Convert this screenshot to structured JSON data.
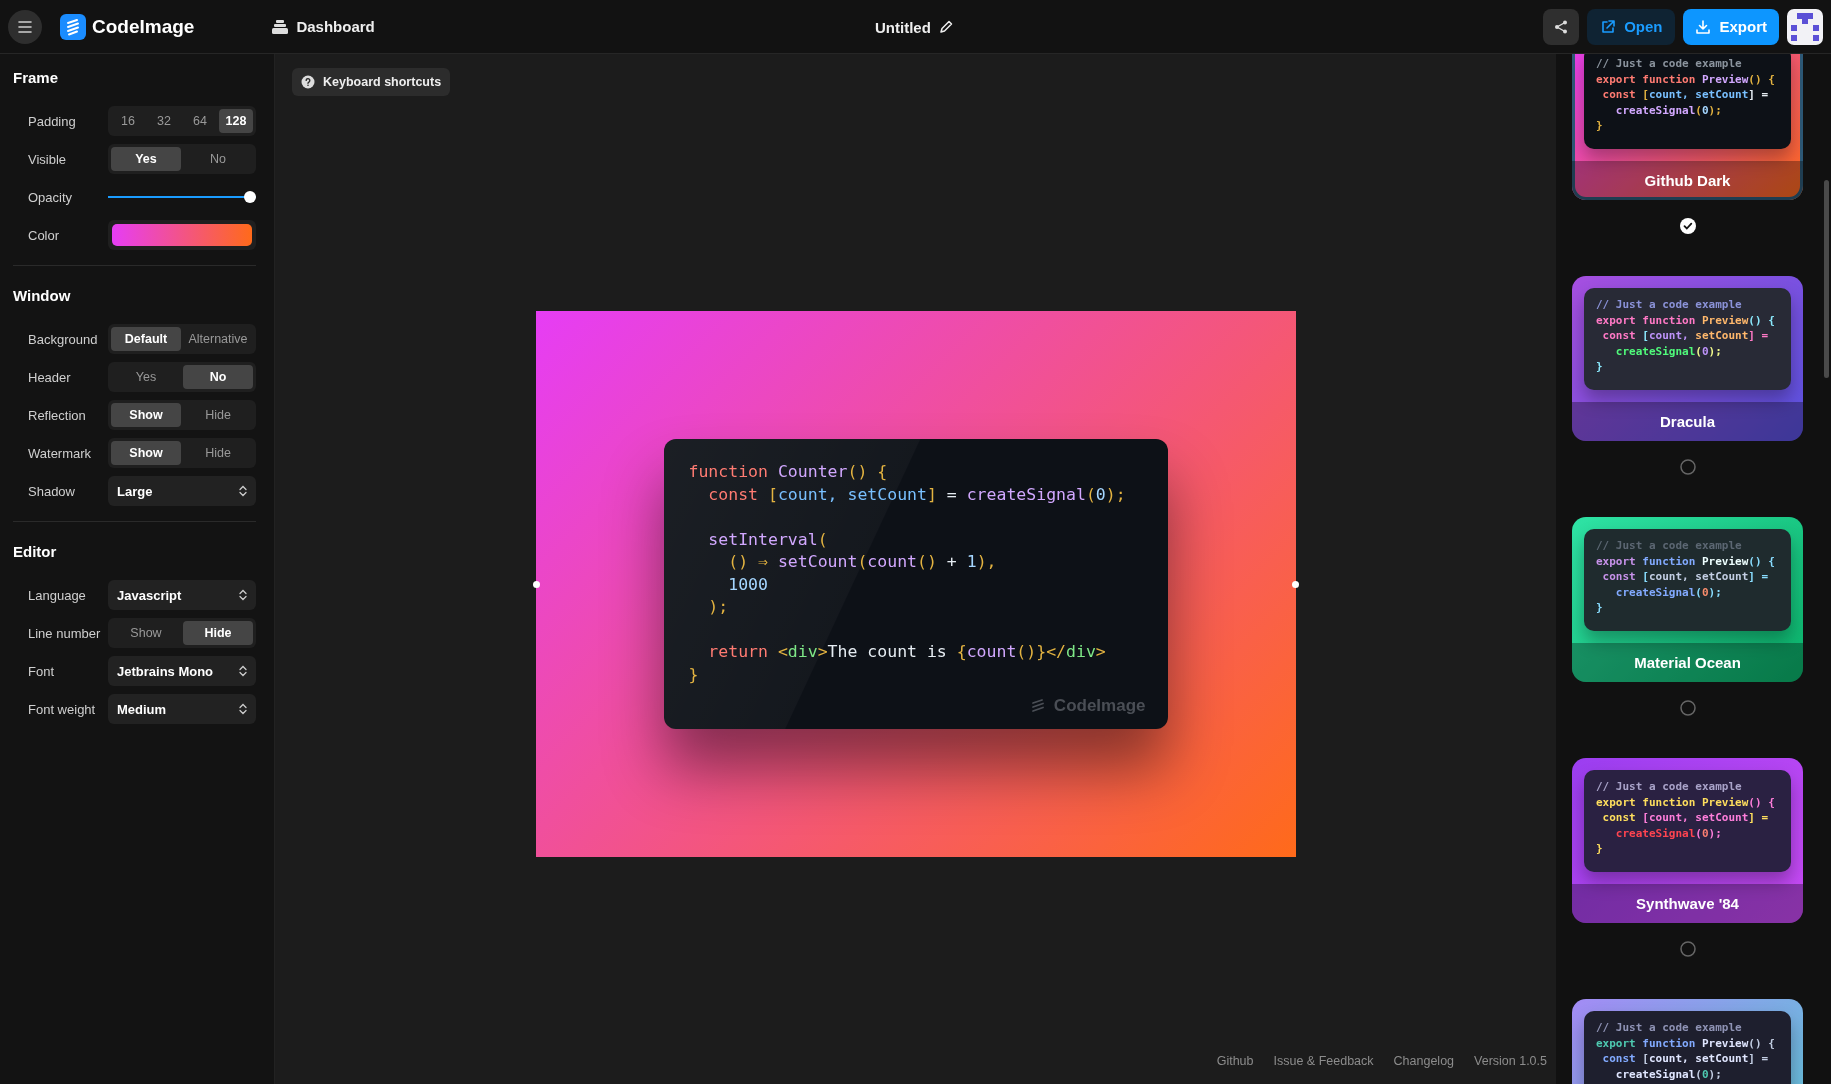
{
  "topbar": {
    "app_name": "CodeImage",
    "nav_link": "Dashboard",
    "title": "Untitled",
    "open_button": "Open",
    "export_button": "Export"
  },
  "sidebar": {
    "sections": [
      {
        "title": "Frame",
        "rows": [
          {
            "label": "Padding",
            "kind": "segmented",
            "options": [
              {
                "label": "16",
                "selected": false
              },
              {
                "label": "32",
                "selected": false
              },
              {
                "label": "64",
                "selected": false
              },
              {
                "label": "128",
                "selected": true
              }
            ]
          },
          {
            "label": "Visible",
            "kind": "segmented",
            "options": [
              {
                "label": "Yes",
                "selected": true
              },
              {
                "label": "No",
                "selected": false
              }
            ]
          },
          {
            "label": "Opacity",
            "kind": "slider",
            "level": 1
          },
          {
            "label": "Color",
            "kind": "gradient"
          }
        ]
      },
      {
        "title": "Window",
        "rows": [
          {
            "label": "Background",
            "kind": "segmented",
            "options": [
              {
                "label": "Default",
                "selected": true
              },
              {
                "label": "Alternative",
                "selected": false
              }
            ]
          },
          {
            "label": "Header",
            "kind": "segmented",
            "options": [
              {
                "label": "Yes",
                "selected": false
              },
              {
                "label": "No",
                "selected": true
              }
            ]
          },
          {
            "label": "Reflection",
            "kind": "segmented",
            "options": [
              {
                "label": "Show",
                "selected": true
              },
              {
                "label": "Hide",
                "selected": false
              }
            ]
          },
          {
            "label": "Watermark",
            "kind": "segmented",
            "options": [
              {
                "label": "Show",
                "selected": true
              },
              {
                "label": "Hide",
                "selected": false
              }
            ]
          },
          {
            "label": "Shadow",
            "kind": "select",
            "value": "Large"
          }
        ]
      },
      {
        "title": "Editor",
        "rows": [
          {
            "label": "Language",
            "kind": "select",
            "value": "Javascript"
          },
          {
            "label": "Line number",
            "kind": "segmented",
            "options": [
              {
                "label": "Show",
                "selected": false
              },
              {
                "label": "Hide",
                "selected": true
              }
            ]
          },
          {
            "label": "Font",
            "kind": "select",
            "value": "Jetbrains Mono"
          },
          {
            "label": "Font weight",
            "kind": "select",
            "value": "Medium"
          }
        ]
      }
    ]
  },
  "canvas": {
    "shortcuts_button": "Keyboard shortcuts",
    "watermark": "CodeImage",
    "code": [
      {
        "tokens": [
          {
            "text": "function ",
            "color": "#ff7b72"
          },
          {
            "text": "Counter",
            "color": "#d2a8ff"
          },
          {
            "text": "() {",
            "color": "#e3b341"
          }
        ]
      },
      {
        "tokens": [
          {
            "text": "  const ",
            "color": "#ff7b72"
          },
          {
            "text": "[",
            "color": "#e3b341"
          },
          {
            "text": "count, setCount",
            "color": "#79c0ff"
          },
          {
            "text": "]",
            "color": "#e3b341"
          },
          {
            "text": " = ",
            "color": "#e6edf3"
          },
          {
            "text": "createSignal",
            "color": "#d2a8ff"
          },
          {
            "text": "(",
            "color": "#e3b341"
          },
          {
            "text": "0",
            "color": "#a5d6ff"
          },
          {
            "text": ");",
            "color": "#e3b341"
          }
        ]
      },
      {
        "blank": true
      },
      {
        "tokens": [
          {
            "text": "  setInterval",
            "color": "#d2a8ff"
          },
          {
            "text": "(",
            "color": "#e3b341"
          }
        ]
      },
      {
        "tokens": [
          {
            "text": "    () ⇒ ",
            "color": "#e3b341"
          },
          {
            "text": "setCount",
            "color": "#d2a8ff"
          },
          {
            "text": "(",
            "color": "#e3b341"
          },
          {
            "text": "count",
            "color": "#d2a8ff"
          },
          {
            "text": "()",
            "color": "#e3b341"
          },
          {
            "text": " + ",
            "color": "#e6edf3"
          },
          {
            "text": "1",
            "color": "#a5d6ff"
          },
          {
            "text": "),",
            "color": "#e3b341"
          }
        ]
      },
      {
        "tokens": [
          {
            "text": "    1000",
            "color": "#a5d6ff"
          }
        ]
      },
      {
        "tokens": [
          {
            "text": "  );",
            "color": "#e3b341"
          }
        ]
      },
      {
        "blank": true
      },
      {
        "tokens": [
          {
            "text": "  return ",
            "color": "#ff7b72"
          },
          {
            "text": "<",
            "color": "#e3b341"
          },
          {
            "text": "div",
            "color": "#7ee787"
          },
          {
            "text": ">",
            "color": "#e3b341"
          },
          {
            "text": "The count is ",
            "color": "#e6edf3"
          },
          {
            "text": "{",
            "color": "#e3b341"
          },
          {
            "text": "count",
            "color": "#d2a8ff"
          },
          {
            "text": "()}</",
            "color": "#e3b341"
          },
          {
            "text": "div",
            "color": "#7ee787"
          },
          {
            "text": ">",
            "color": "#e3b341"
          }
        ]
      },
      {
        "tokens": [
          {
            "text": "}",
            "color": "#e3b341"
          }
        ]
      }
    ],
    "footer_links": [
      "Github",
      "Issue & Feedback",
      "Changelog"
    ],
    "version": "Version 1.0.5"
  },
  "themes": [
    {
      "name": "Github Dark",
      "selected": true,
      "lines": [
        [
          {
            "text": "// Just a code example",
            "color": "#8b949e"
          }
        ],
        [
          {
            "text": "export function ",
            "color": "#ff7b72"
          },
          {
            "text": "Preview",
            "color": "#d2a8ff"
          },
          {
            "text": "() {",
            "color": "#e3b341"
          }
        ],
        [
          {
            "text": " const ",
            "color": "#ff7b72"
          },
          {
            "text": "[",
            "color": "#e3b341"
          },
          {
            "text": "count, setCount",
            "color": "#79c0ff"
          },
          {
            "text": "] =",
            "color": "#e6edf3"
          }
        ],
        [
          {
            "text": "   createSignal",
            "color": "#d2a8ff"
          },
          {
            "text": "(",
            "color": "#e3b341"
          },
          {
            "text": "0",
            "color": "#a5d6ff"
          },
          {
            "text": ");",
            "color": "#e3b341"
          }
        ],
        [
          {
            "text": "}",
            "color": "#e3b341"
          }
        ]
      ]
    },
    {
      "name": "Dracula",
      "selected": false,
      "lines": [
        [
          {
            "text": "// Just a code example",
            "color": "#8b93d9"
          }
        ],
        [
          {
            "text": "export function ",
            "color": "#ff79c6"
          },
          {
            "text": "Preview",
            "color": "#ffb86c"
          },
          {
            "text": "() {",
            "color": "#8be9fd"
          }
        ],
        [
          {
            "text": " const ",
            "color": "#ff79c6"
          },
          {
            "text": "[",
            "color": "#8be9fd"
          },
          {
            "text": "count, ",
            "color": "#bd93f9"
          },
          {
            "text": "setCount",
            "color": "#ffb86c"
          },
          {
            "text": "] =",
            "color": "#ff79c6"
          }
        ],
        [
          {
            "text": "   createSignal",
            "color": "#50fa7b"
          },
          {
            "text": "(",
            "color": "#f1fa8c"
          },
          {
            "text": "0",
            "color": "#bd93f9"
          },
          {
            "text": ");",
            "color": "#f1fa8c"
          }
        ],
        [
          {
            "text": "}",
            "color": "#8be9fd"
          }
        ]
      ]
    },
    {
      "name": "Material Ocean",
      "selected": false,
      "lines": [
        [
          {
            "text": "// Just a code example",
            "color": "#5c6773"
          }
        ],
        [
          {
            "text": "export ",
            "color": "#c792ea"
          },
          {
            "text": "function ",
            "color": "#82aaff"
          },
          {
            "text": "Preview",
            "color": "#eeffff"
          },
          {
            "text": "() {",
            "color": "#89ddff"
          }
        ],
        [
          {
            "text": " const ",
            "color": "#c792ea"
          },
          {
            "text": "[",
            "color": "#89ddff"
          },
          {
            "text": "count, setCount",
            "color": "#c3cee3"
          },
          {
            "text": "] =",
            "color": "#89ddff"
          }
        ],
        [
          {
            "text": "   createSignal",
            "color": "#82aaff"
          },
          {
            "text": "(",
            "color": "#89ddff"
          },
          {
            "text": "0",
            "color": "#f78c6c"
          },
          {
            "text": ");",
            "color": "#89ddff"
          }
        ],
        [
          {
            "text": "}",
            "color": "#89ddff"
          }
        ]
      ]
    },
    {
      "name": "Synthwave '84",
      "selected": false,
      "lines": [
        [
          {
            "text": "// Just a code example",
            "color": "#a9a3c9"
          }
        ],
        [
          {
            "text": "export function ",
            "color": "#fede5d"
          },
          {
            "text": "Preview",
            "color": "#fede5d"
          },
          {
            "text": "() {",
            "color": "#ff7edb"
          }
        ],
        [
          {
            "text": " const ",
            "color": "#fede5d"
          },
          {
            "text": "[",
            "color": "#ff7edb"
          },
          {
            "text": "count, setCount",
            "color": "#ff7edb"
          },
          {
            "text": "] =",
            "color": "#fede5d"
          }
        ],
        [
          {
            "text": "   createSignal",
            "color": "#fe4450"
          },
          {
            "text": "(",
            "color": "#ff7edb"
          },
          {
            "text": "0",
            "color": "#f97e72"
          },
          {
            "text": ");",
            "color": "#ff7edb"
          }
        ],
        [
          {
            "text": "}",
            "color": "#fede5d"
          }
        ]
      ]
    },
    {
      "lines": [
        [
          {
            "text": "// Just a code example",
            "color": "#8f93b5"
          }
        ],
        [
          {
            "text": "export ",
            "color": "#4ec9b0"
          },
          {
            "text": "function ",
            "color": "#82aaff"
          },
          {
            "text": "Preview",
            "color": "#e0e6ff"
          },
          {
            "text": "() {",
            "color": "#c3cee3"
          }
        ],
        [
          {
            "text": " const ",
            "color": "#82aaff"
          },
          {
            "text": "[",
            "color": "#c3cee3"
          },
          {
            "text": "count, setCount",
            "color": "#e0e6ff"
          },
          {
            "text": "] =",
            "color": "#c3cee3"
          }
        ],
        [
          {
            "text": "   createSignal",
            "color": "#e0e6ff"
          },
          {
            "text": "(",
            "color": "#c3cee3"
          },
          {
            "text": "0",
            "color": "#4ec9b0"
          },
          {
            "text": ");",
            "color": "#c3cee3"
          }
        ]
      ]
    }
  ]
}
